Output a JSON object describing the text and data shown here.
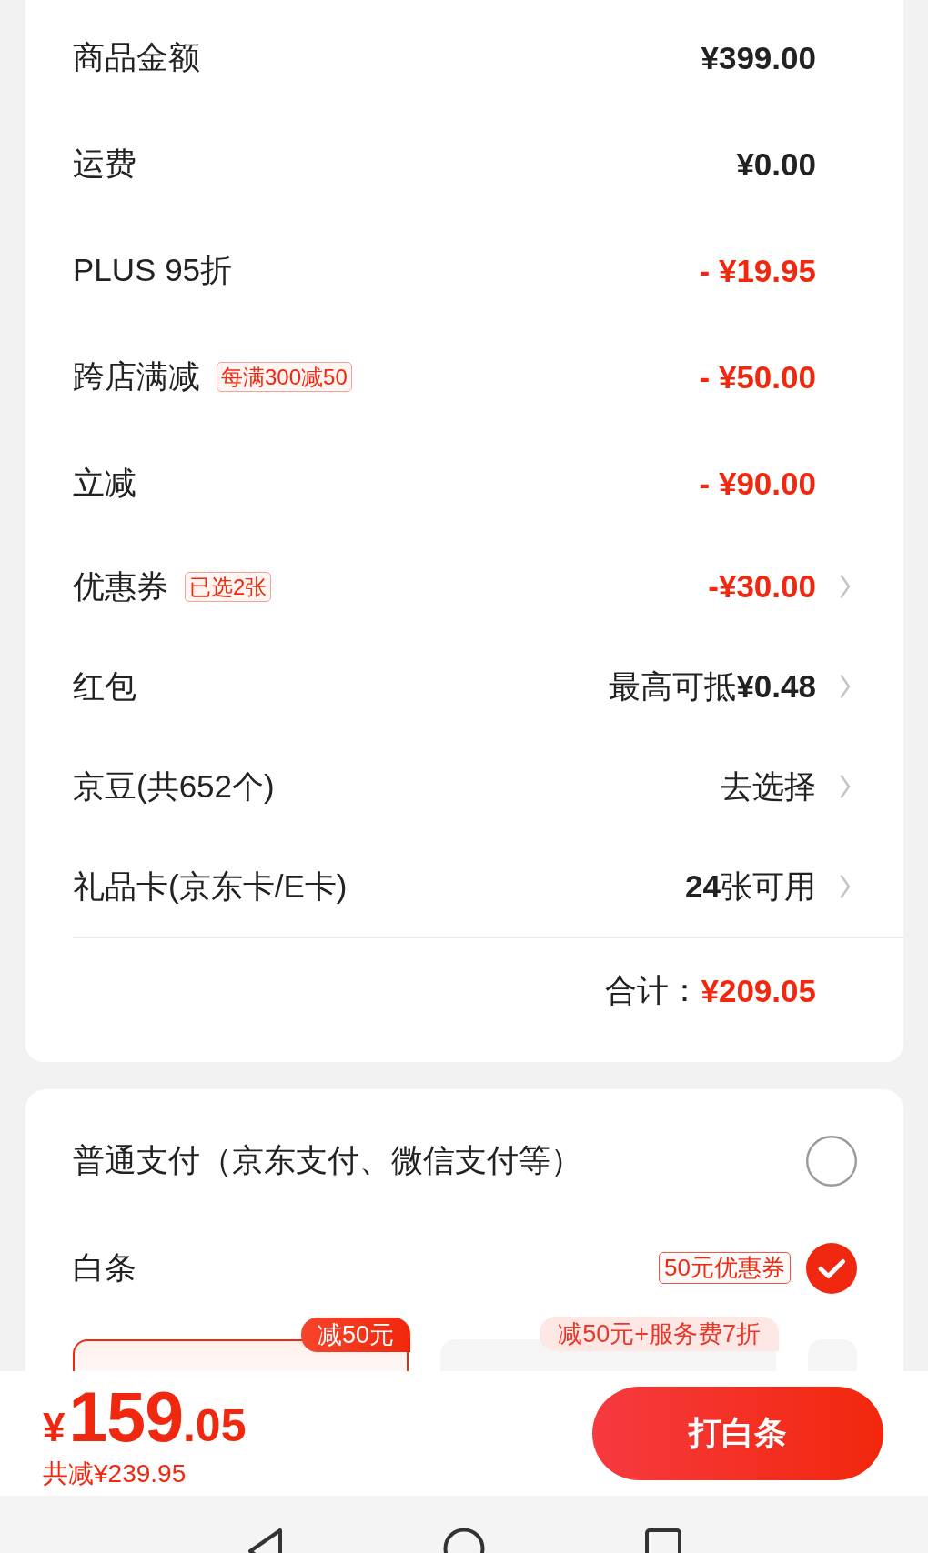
{
  "price_summary": {
    "rows": [
      {
        "label": "商品金额",
        "value": "¥399.00",
        "kind": "amount",
        "chevron": false
      },
      {
        "label": "运费",
        "value": "¥0.00",
        "kind": "amount",
        "chevron": false
      },
      {
        "label": "PLUS 95折",
        "value": "- ¥19.95",
        "kind": "discount",
        "chevron": false
      },
      {
        "label": "跨店满减",
        "tag": "每满300减50",
        "value": "- ¥50.00",
        "kind": "discount",
        "chevron": false
      },
      {
        "label": "立减",
        "value": "- ¥90.00",
        "kind": "discount",
        "chevron": false
      },
      {
        "label": "优惠券",
        "tag": "已选2张",
        "value": "-¥30.00",
        "kind": "discount",
        "chevron": true
      },
      {
        "label": "红包",
        "value": "最高可抵**¥0.48**",
        "kind": "text",
        "chevron": true
      },
      {
        "label": "京豆(共652个)",
        "value": "去选择",
        "kind": "text",
        "chevron": true
      },
      {
        "label": "礼品卡(京东卡/E卡)",
        "value": "**24**张可用",
        "kind": "text",
        "chevron": true
      }
    ],
    "total": {
      "label": "合计：",
      "value": "¥209.05"
    }
  },
  "payment_methods": [
    {
      "label": "普通支付（京东支付、微信支付等）",
      "selected": false
    },
    {
      "label": "白条",
      "tag": "50元优惠券",
      "selected": true
    }
  ],
  "installment_plans": [
    {
      "badge": "减50元",
      "selected": true
    },
    {
      "badge": "减50元+服务费7折",
      "selected": false
    },
    {
      "selected": false
    }
  ],
  "bottom_bar": {
    "price": {
      "currency": "¥",
      "integer": "159",
      "decimal": ".05"
    },
    "savings": "共减¥239.95",
    "submit_button": "打白条"
  }
}
